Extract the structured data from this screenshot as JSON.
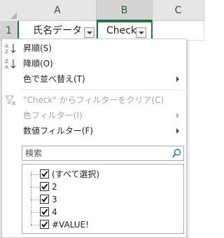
{
  "sheet": {
    "columns": [
      "A",
      "B",
      "C"
    ],
    "selected_column": "B",
    "rows": [
      "1"
    ],
    "cells": {
      "A1": "氏名データ",
      "B1": "Check"
    }
  },
  "menu": {
    "sort_asc": "昇順(S)",
    "sort_desc": "降順(O)",
    "sort_by_color": "色で並べ替え(T)",
    "clear_filter": "\"Check\" からフィルターをクリア(C)",
    "color_filter": "色フィルター(I)",
    "number_filter": "数値フィルター(F)",
    "search_placeholder": "検索",
    "items": [
      {
        "label": "(すべて選択)",
        "checked": true
      },
      {
        "label": "2",
        "checked": true
      },
      {
        "label": "3",
        "checked": true
      },
      {
        "label": "4",
        "checked": true
      },
      {
        "label": "#VALUE!",
        "checked": true
      }
    ]
  },
  "icons": {
    "sort_asc": "sort-ascending-icon",
    "sort_desc": "sort-descending-icon",
    "clear_filter": "clear-filter-icon",
    "search": "magnifier-icon",
    "submenu": "chevron-right-icon"
  },
  "colors": {
    "accent_green": "#217346",
    "sort_blue": "#2e6fb4",
    "disabled_text": "#a6a6a6"
  }
}
